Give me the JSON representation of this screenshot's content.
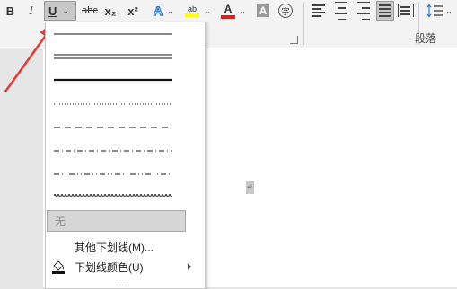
{
  "ribbon": {
    "bold_label": "B",
    "italic_label": "I",
    "underline_label": "U",
    "strikethrough_label": "abc",
    "subscript_label": "x₂",
    "superscript_label": "x²",
    "highlight_label": "ab",
    "font_color_label": "A",
    "char_shading_label": "A",
    "enclose_char_label": "字",
    "paragraph_group_label": "段落"
  },
  "underline_menu": {
    "styles": [
      "single",
      "double",
      "thick",
      "dotted",
      "dashed",
      "dash-dot",
      "dash-dot-dot",
      "wave"
    ],
    "none_label": "无",
    "more_label": "其他下划线(M)...",
    "color_label": "下划线颜色(U)",
    "grip": "....."
  },
  "colors": {
    "accent_arrow": "#e53935",
    "highlight_yellow": "#ffff00",
    "font_color_red": "#e31b23",
    "text_effects_blue": "#2b7cd3"
  },
  "icons": [
    "bold-icon",
    "italic-icon",
    "underline-icon",
    "strikethrough-icon",
    "subscript-icon",
    "superscript-icon",
    "text-effects-icon",
    "highlight-icon",
    "font-color-icon",
    "char-shading-icon",
    "enclose-char-icon",
    "align-left-icon",
    "align-center-icon",
    "align-right-icon",
    "justify-icon",
    "distributed-icon",
    "line-spacing-icon",
    "paint-bucket-icon"
  ]
}
